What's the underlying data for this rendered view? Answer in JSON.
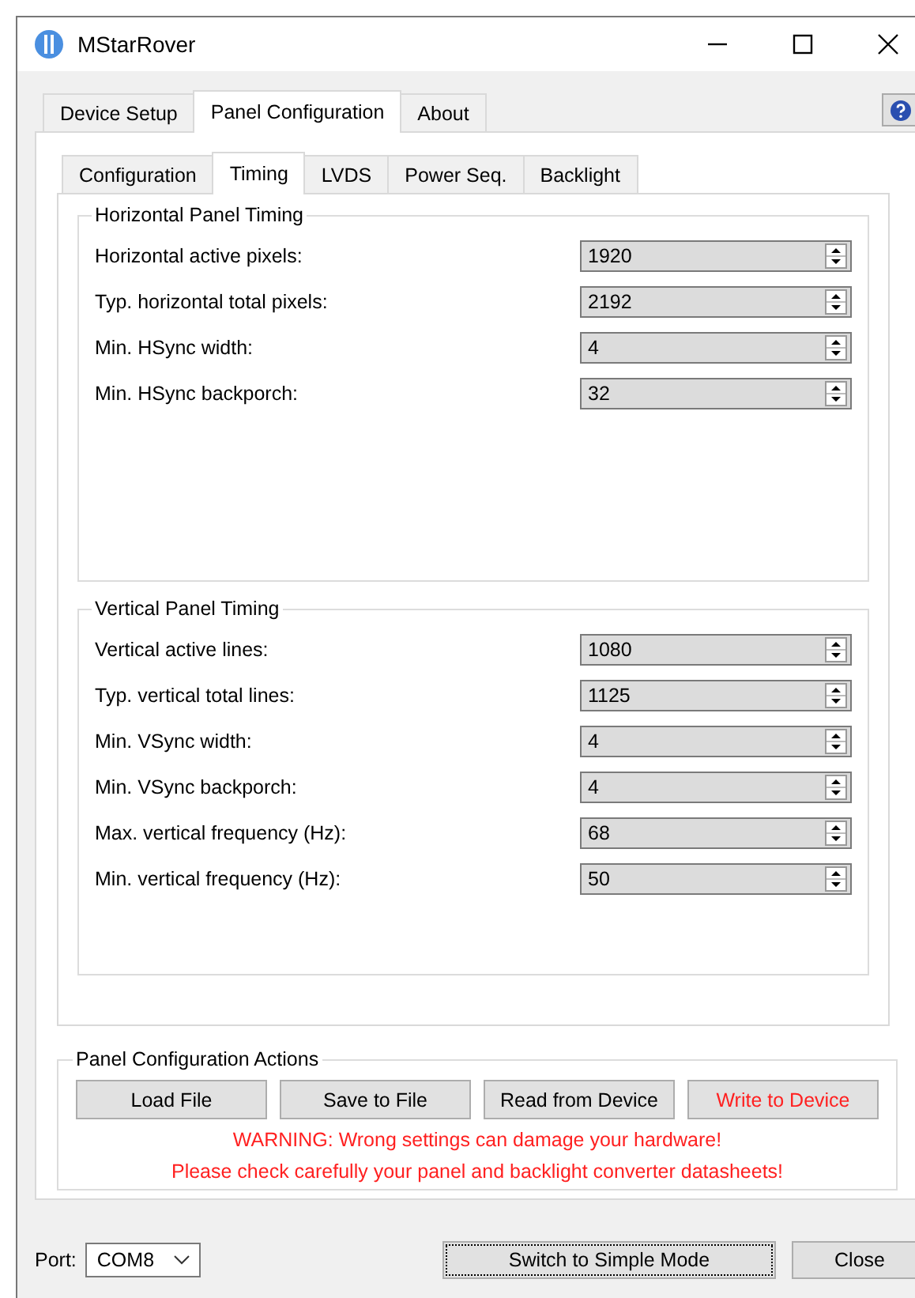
{
  "window": {
    "title": "MStarRover"
  },
  "tabs": [
    {
      "label": "Device Setup",
      "selected": false
    },
    {
      "label": "Panel Configuration",
      "selected": true
    },
    {
      "label": "About",
      "selected": false
    }
  ],
  "subtabs": [
    {
      "label": "Configuration",
      "selected": false
    },
    {
      "label": "Timing",
      "selected": true
    },
    {
      "label": "LVDS",
      "selected": false
    },
    {
      "label": "Power Seq.",
      "selected": false
    },
    {
      "label": "Backlight",
      "selected": false
    }
  ],
  "groups": [
    {
      "title": "Horizontal Panel Timing",
      "fields": [
        {
          "label": "Horizontal active pixels:",
          "value": "1920"
        },
        {
          "label": "Typ. horizontal total pixels:",
          "value": "2192"
        },
        {
          "label": "Min. HSync width:",
          "value": "4"
        },
        {
          "label": "Min. HSync backporch:",
          "value": "32"
        }
      ]
    },
    {
      "title": "Vertical Panel Timing",
      "fields": [
        {
          "label": "Vertical active lines:",
          "value": "1080"
        },
        {
          "label": "Typ. vertical total lines:",
          "value": "1125"
        },
        {
          "label": "Min. VSync width:",
          "value": "4"
        },
        {
          "label": "Min. VSync backporch:",
          "value": "4"
        },
        {
          "label": "Max. vertical frequency (Hz):",
          "value": "68"
        },
        {
          "label": "Min. vertical frequency (Hz):",
          "value": "50"
        }
      ]
    }
  ],
  "actions": {
    "title": "Panel Configuration Actions",
    "buttons": [
      {
        "label": "Load File",
        "warning": false
      },
      {
        "label": "Save to File",
        "warning": false
      },
      {
        "label": "Read from Device",
        "warning": false
      },
      {
        "label": "Write to Device",
        "warning": true
      }
    ],
    "warnings": [
      "WARNING: Wrong settings can damage your hardware!",
      "Please check carefully your panel and backlight converter datasheets!"
    ]
  },
  "footer": {
    "port_label": "Port:",
    "port_value": "COM8",
    "buttons": [
      {
        "label": "Switch to Simple Mode",
        "focused": true
      },
      {
        "label": "Close",
        "focused": false
      }
    ]
  }
}
